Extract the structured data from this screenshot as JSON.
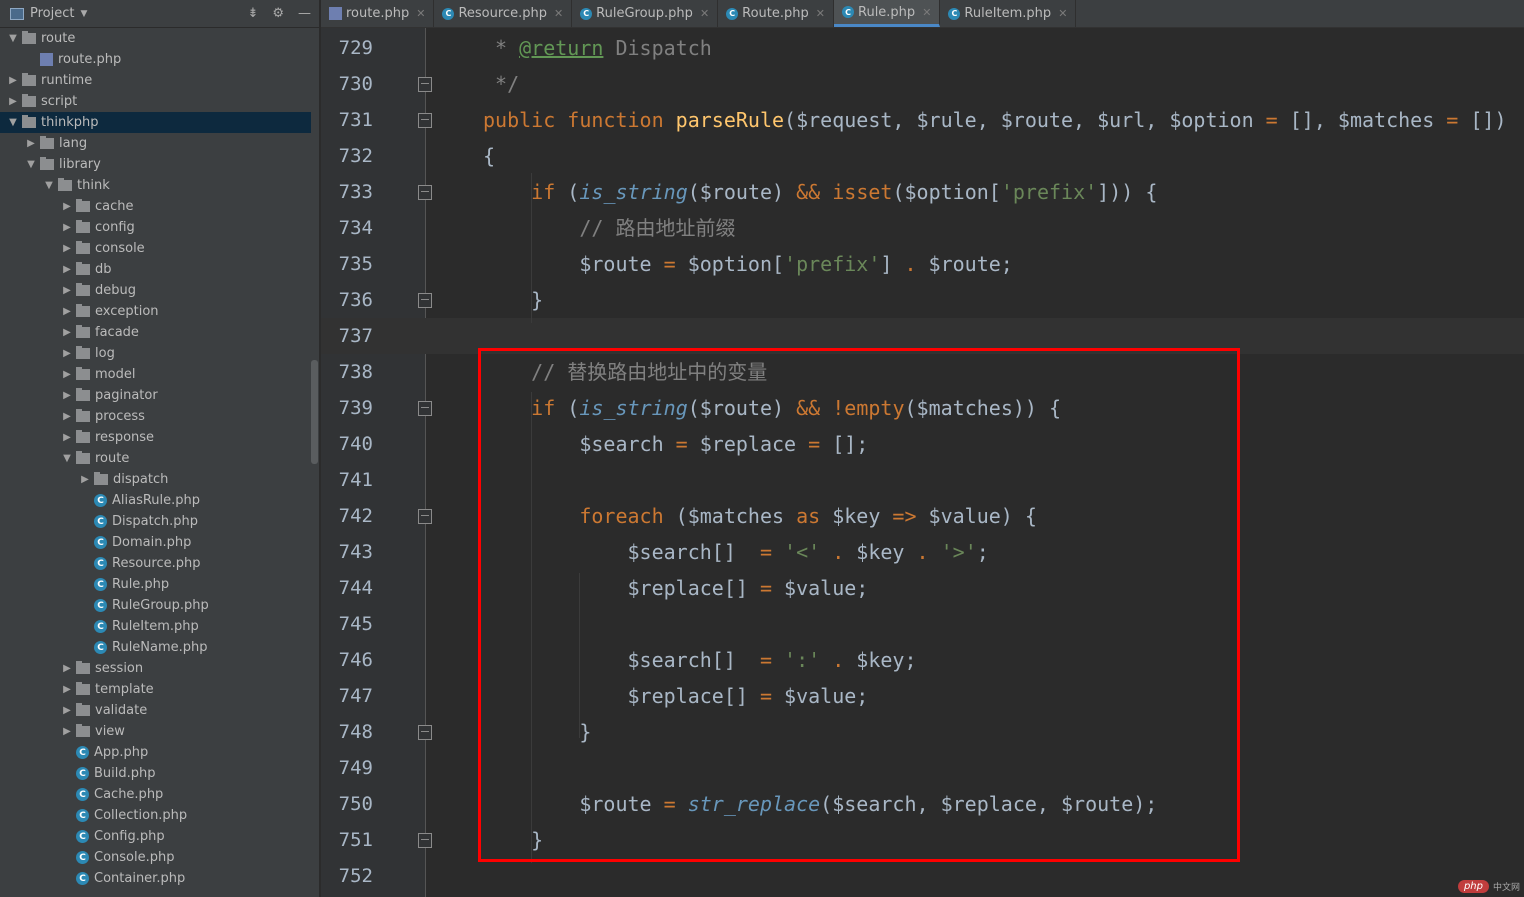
{
  "sidebar": {
    "title": "Project",
    "tree": [
      {
        "label": "route",
        "depth": 1,
        "type": "folder",
        "expanded": true
      },
      {
        "label": "route.php",
        "depth": 2,
        "type": "php"
      },
      {
        "label": "runtime",
        "depth": 1,
        "type": "folder",
        "expanded": false
      },
      {
        "label": "script",
        "depth": 1,
        "type": "folder",
        "expanded": false
      },
      {
        "label": "thinkphp",
        "depth": 1,
        "type": "folder",
        "expanded": true,
        "selected": true
      },
      {
        "label": "lang",
        "depth": 2,
        "type": "folder",
        "expanded": false
      },
      {
        "label": "library",
        "depth": 2,
        "type": "folder",
        "expanded": true
      },
      {
        "label": "think",
        "depth": 3,
        "type": "folder",
        "expanded": true
      },
      {
        "label": "cache",
        "depth": 4,
        "type": "folder",
        "expanded": false
      },
      {
        "label": "config",
        "depth": 4,
        "type": "folder",
        "expanded": false
      },
      {
        "label": "console",
        "depth": 4,
        "type": "folder",
        "expanded": false
      },
      {
        "label": "db",
        "depth": 4,
        "type": "folder",
        "expanded": false
      },
      {
        "label": "debug",
        "depth": 4,
        "type": "folder",
        "expanded": false
      },
      {
        "label": "exception",
        "depth": 4,
        "type": "folder",
        "expanded": false
      },
      {
        "label": "facade",
        "depth": 4,
        "type": "folder",
        "expanded": false
      },
      {
        "label": "log",
        "depth": 4,
        "type": "folder",
        "expanded": false
      },
      {
        "label": "model",
        "depth": 4,
        "type": "folder",
        "expanded": false
      },
      {
        "label": "paginator",
        "depth": 4,
        "type": "folder",
        "expanded": false
      },
      {
        "label": "process",
        "depth": 4,
        "type": "folder",
        "expanded": false
      },
      {
        "label": "response",
        "depth": 4,
        "type": "folder",
        "expanded": false
      },
      {
        "label": "route",
        "depth": 4,
        "type": "folder",
        "expanded": true
      },
      {
        "label": "dispatch",
        "depth": 5,
        "type": "folder",
        "expanded": false
      },
      {
        "label": "AliasRule.php",
        "depth": 5,
        "type": "class"
      },
      {
        "label": "Dispatch.php",
        "depth": 5,
        "type": "class"
      },
      {
        "label": "Domain.php",
        "depth": 5,
        "type": "class"
      },
      {
        "label": "Resource.php",
        "depth": 5,
        "type": "class"
      },
      {
        "label": "Rule.php",
        "depth": 5,
        "type": "class"
      },
      {
        "label": "RuleGroup.php",
        "depth": 5,
        "type": "class"
      },
      {
        "label": "RuleItem.php",
        "depth": 5,
        "type": "class"
      },
      {
        "label": "RuleName.php",
        "depth": 5,
        "type": "class"
      },
      {
        "label": "session",
        "depth": 4,
        "type": "folder",
        "expanded": false
      },
      {
        "label": "template",
        "depth": 4,
        "type": "folder",
        "expanded": false
      },
      {
        "label": "validate",
        "depth": 4,
        "type": "folder",
        "expanded": false
      },
      {
        "label": "view",
        "depth": 4,
        "type": "folder",
        "expanded": false
      },
      {
        "label": "App.php",
        "depth": 4,
        "type": "class"
      },
      {
        "label": "Build.php",
        "depth": 4,
        "type": "class"
      },
      {
        "label": "Cache.php",
        "depth": 4,
        "type": "class"
      },
      {
        "label": "Collection.php",
        "depth": 4,
        "type": "class"
      },
      {
        "label": "Config.php",
        "depth": 4,
        "type": "class"
      },
      {
        "label": "Console.php",
        "depth": 4,
        "type": "class"
      },
      {
        "label": "Container.php",
        "depth": 4,
        "type": "class"
      }
    ]
  },
  "tabs": [
    {
      "label": "route.php",
      "type": "php",
      "active": false
    },
    {
      "label": "Resource.php",
      "type": "class",
      "active": false
    },
    {
      "label": "RuleGroup.php",
      "type": "class",
      "active": false
    },
    {
      "label": "Route.php",
      "type": "class",
      "active": false
    },
    {
      "label": "Rule.php",
      "type": "class",
      "active": true
    },
    {
      "label": "RuleItem.php",
      "type": "class",
      "active": false
    }
  ],
  "editor": {
    "current_line": 737,
    "lines": [
      {
        "num": "729",
        "fold": false,
        "tokens": [
          [
            "t-com",
            " * "
          ],
          [
            "t-tag",
            "@return"
          ],
          [
            "t-com",
            " Dispatch"
          ]
        ]
      },
      {
        "num": "730",
        "fold": true,
        "tokens": [
          [
            "t-com",
            " */"
          ]
        ]
      },
      {
        "num": "731",
        "fold": true,
        "tokens": [
          [
            "t-kw",
            "public function "
          ],
          [
            "t-fn",
            "parseRule"
          ],
          [
            "",
            "($request, $rule, $route, $url, $option "
          ],
          [
            "t-kw",
            "="
          ],
          [
            "",
            " [], $matches "
          ],
          [
            "t-kw",
            "="
          ],
          [
            "",
            " [])"
          ]
        ]
      },
      {
        "num": "732",
        "fold": false,
        "tokens": [
          [
            "",
            "{"
          ]
        ]
      },
      {
        "num": "733",
        "fold": true,
        "tokens": [
          [
            "",
            "    "
          ],
          [
            "t-kw",
            "if"
          ],
          [
            "",
            " ("
          ],
          [
            "t-it",
            "is_string"
          ],
          [
            "",
            "($route) "
          ],
          [
            "t-kw",
            "&&"
          ],
          [
            "",
            " "
          ],
          [
            "t-kw",
            "isset"
          ],
          [
            "",
            "($option["
          ],
          [
            "t-str",
            "'prefix'"
          ],
          [
            "",
            "])) {"
          ]
        ]
      },
      {
        "num": "734",
        "fold": false,
        "tokens": [
          [
            "",
            "        "
          ],
          [
            "t-com",
            "// 路由地址前缀"
          ]
        ]
      },
      {
        "num": "735",
        "fold": false,
        "tokens": [
          [
            "",
            "        $route "
          ],
          [
            "t-kw",
            "="
          ],
          [
            "",
            " $option["
          ],
          [
            "t-str",
            "'prefix'"
          ],
          [
            "",
            "] "
          ],
          [
            "t-kw",
            "."
          ],
          [
            "",
            " $route;"
          ]
        ]
      },
      {
        "num": "736",
        "fold": true,
        "tokens": [
          [
            "",
            "    }"
          ]
        ]
      },
      {
        "num": "737",
        "fold": false,
        "tokens": []
      },
      {
        "num": "738",
        "fold": false,
        "tokens": [
          [
            "",
            "    "
          ],
          [
            "t-com",
            "// 替换路由地址中的变量"
          ]
        ]
      },
      {
        "num": "739",
        "fold": true,
        "tokens": [
          [
            "",
            "    "
          ],
          [
            "t-kw",
            "if"
          ],
          [
            "",
            " ("
          ],
          [
            "t-it",
            "is_string"
          ],
          [
            "",
            "($route) "
          ],
          [
            "t-kw",
            "&&"
          ],
          [
            "",
            " "
          ],
          [
            "t-kw",
            "!empty"
          ],
          [
            "",
            "($matches)) {"
          ]
        ]
      },
      {
        "num": "740",
        "fold": false,
        "tokens": [
          [
            "",
            "        $search "
          ],
          [
            "t-kw",
            "="
          ],
          [
            "",
            " $replace "
          ],
          [
            "t-kw",
            "="
          ],
          [
            "",
            " [];"
          ]
        ]
      },
      {
        "num": "741",
        "fold": false,
        "tokens": []
      },
      {
        "num": "742",
        "fold": true,
        "tokens": [
          [
            "",
            "        "
          ],
          [
            "t-kw",
            "foreach"
          ],
          [
            "",
            " ($matches "
          ],
          [
            "t-kw",
            "as"
          ],
          [
            "",
            " $key "
          ],
          [
            "t-kw",
            "=>"
          ],
          [
            "",
            " $value) {"
          ]
        ]
      },
      {
        "num": "743",
        "fold": false,
        "tokens": [
          [
            "",
            "            $search[]  "
          ],
          [
            "t-kw",
            "="
          ],
          [
            "",
            " "
          ],
          [
            "t-str",
            "'<'"
          ],
          [
            "",
            " "
          ],
          [
            "t-kw",
            "."
          ],
          [
            "",
            " $key "
          ],
          [
            "t-kw",
            "."
          ],
          [
            "",
            " "
          ],
          [
            "t-str",
            "'>'"
          ],
          [
            "",
            ";"
          ]
        ]
      },
      {
        "num": "744",
        "fold": false,
        "tokens": [
          [
            "",
            "            $replace[] "
          ],
          [
            "t-kw",
            "="
          ],
          [
            "",
            " $value;"
          ]
        ]
      },
      {
        "num": "745",
        "fold": false,
        "tokens": []
      },
      {
        "num": "746",
        "fold": false,
        "tokens": [
          [
            "",
            "            $search[]  "
          ],
          [
            "t-kw",
            "="
          ],
          [
            "",
            " "
          ],
          [
            "t-str",
            "':'"
          ],
          [
            "",
            " "
          ],
          [
            "t-kw",
            "."
          ],
          [
            "",
            " $key;"
          ]
        ]
      },
      {
        "num": "747",
        "fold": false,
        "tokens": [
          [
            "",
            "            $replace[] "
          ],
          [
            "t-kw",
            "="
          ],
          [
            "",
            " $value;"
          ]
        ]
      },
      {
        "num": "748",
        "fold": true,
        "tokens": [
          [
            "",
            "        }"
          ]
        ]
      },
      {
        "num": "749",
        "fold": false,
        "tokens": []
      },
      {
        "num": "750",
        "fold": false,
        "tokens": [
          [
            "",
            "        $route "
          ],
          [
            "t-kw",
            "="
          ],
          [
            "",
            " "
          ],
          [
            "t-it",
            "str_replace"
          ],
          [
            "",
            "($search, $replace, $route);"
          ]
        ]
      },
      {
        "num": "751",
        "fold": true,
        "tokens": [
          [
            "",
            "    }"
          ]
        ]
      },
      {
        "num": "752",
        "fold": false,
        "tokens": []
      }
    ]
  },
  "watermark": {
    "badge": "php",
    "text": "中文网"
  },
  "colors": {
    "selection": "#0d293e",
    "highlight_box": "#ff0000",
    "active_tab_underline": "#4a88c7"
  }
}
